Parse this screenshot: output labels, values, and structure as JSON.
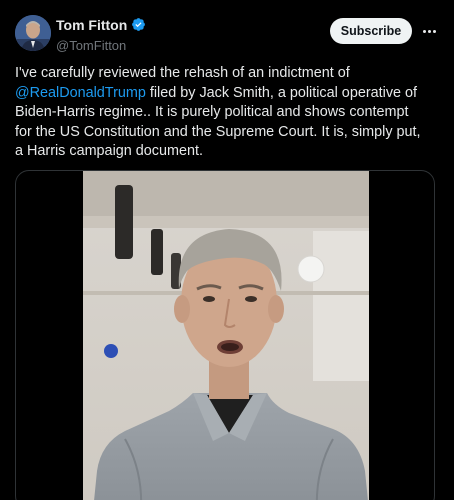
{
  "tweet": {
    "author": {
      "display_name": "Tom Fitton",
      "handle": "@TomFitton",
      "verified": true,
      "verified_color": "#1d9bf0"
    },
    "subscribe_label": "Subscribe",
    "text_lines": {
      "line1": "I've carefully reviewed the rehash of an indictment of",
      "mention": "@RealDonaldTrump",
      "line2_rest": " filed by Jack Smith, a political operative of",
      "line3": "Biden-Harris regime.. It is purely political and shows contempt",
      "line4": "for the US Constitution and the Supreme Court. It is, simply put,",
      "line5": "a Harris campaign document."
    },
    "media": {
      "type": "video"
    }
  },
  "colors": {
    "background": "#000000",
    "text": "#e7e9ea",
    "secondary_text": "#71767b",
    "link": "#1d9bf0",
    "border": "#2f3336"
  },
  "icons": {
    "verified": "verified-badge-icon",
    "more": "more-horizontal-icon"
  }
}
